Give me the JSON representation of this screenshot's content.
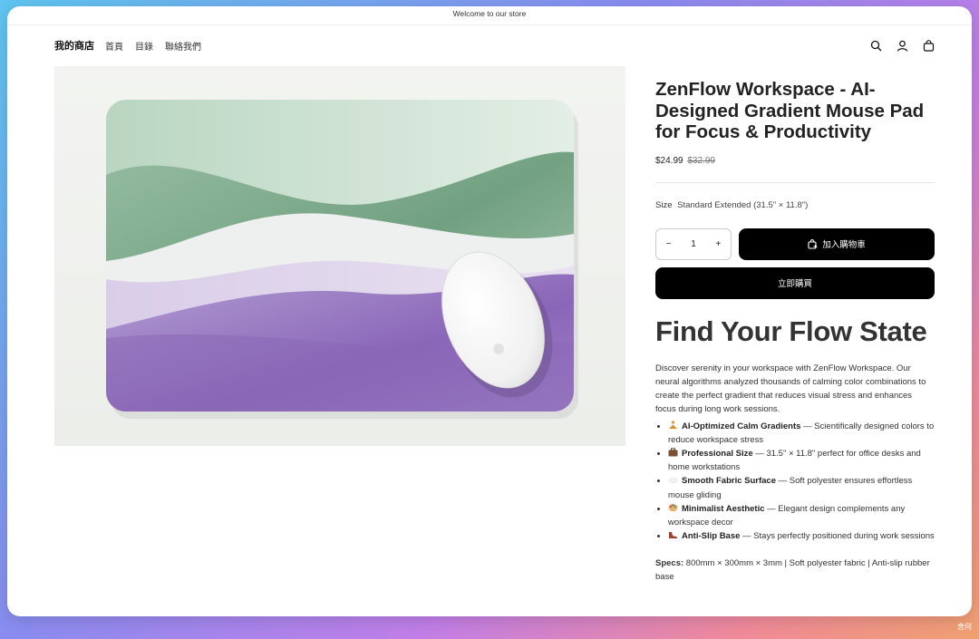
{
  "announcement": "Welcome to our store",
  "header": {
    "logo": "我的商店",
    "nav": [
      "首頁",
      "目錄",
      "聯絡我們"
    ],
    "icons": [
      "search-icon",
      "account-icon",
      "cart-icon"
    ]
  },
  "product": {
    "title": "ZenFlow Workspace - AI-Designed Gradient Mouse Pad for Focus & Productivity",
    "price": "$24.99",
    "compare_price": "$32.99",
    "size_label": "Size",
    "size_value": "Standard Extended (31.5\" × 11.8\")",
    "quantity": "1",
    "qty_minus": "−",
    "qty_plus": "+",
    "add_to_cart": "加入購物車",
    "buy_now": "立即購買",
    "heading": "Find Your Flow State",
    "description": "Discover serenity in your workspace with ZenFlow Workspace. Our neural algorithms analyzed thousands of calming color combinations to create the perfect gradient that reduces visual stress and enhances focus during long work sessions.",
    "features": [
      {
        "icon": "meditation-icon",
        "bold": "AI-Optimized Calm Gradients",
        "text": " — Scientifically designed colors to reduce workspace stress"
      },
      {
        "icon": "briefcase-icon",
        "bold": "Professional Size",
        "text": " — 31.5\" × 11.8\" perfect for office desks and home workstations"
      },
      {
        "icon": "cloud-icon",
        "bold": "Smooth Fabric Surface",
        "text": " — Soft polyester ensures effortless mouse gliding"
      },
      {
        "icon": "palette-icon",
        "bold": "Minimalist Aesthetic",
        "text": " — Elegant design complements any workspace decor"
      },
      {
        "icon": "shoe-icon",
        "bold": "Anti-Slip Base",
        "text": " — Stays perfectly positioned during work sessions"
      }
    ],
    "specs_label": "Specs:",
    "specs_text": " 800mm × 300mm × 3mm | Soft polyester fabric | Anti-slip rubber base"
  },
  "corner_mark": "舍何",
  "colors": {
    "button_bg": "#000000",
    "text": "#121212",
    "pad_green": "#5f9470",
    "pad_purple": "#8a66b8"
  }
}
